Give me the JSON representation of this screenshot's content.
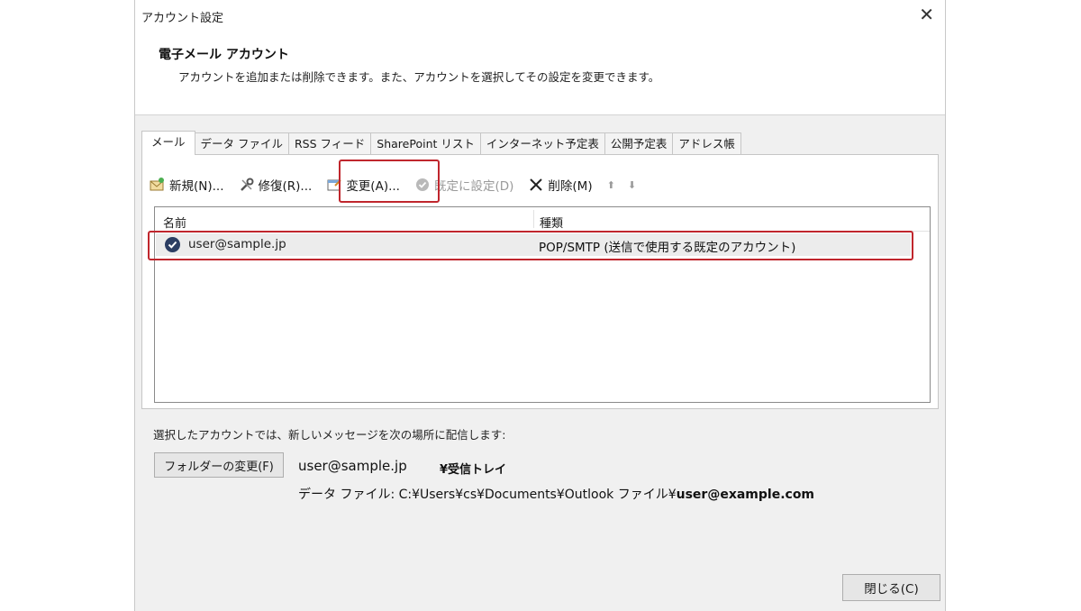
{
  "window": {
    "title": "アカウント設定",
    "close_glyph": "✕"
  },
  "header": {
    "heading": "電子メール アカウント",
    "description": "アカウントを追加または削除できます。また、アカウントを選択してその設定を変更できます。"
  },
  "tabs": [
    {
      "label": "メール",
      "active": true
    },
    {
      "label": "データ ファイル"
    },
    {
      "label": "RSS フィード"
    },
    {
      "label": "SharePoint リスト"
    },
    {
      "label": "インターネット予定表"
    },
    {
      "label": "公開予定表"
    },
    {
      "label": "アドレス帳"
    }
  ],
  "toolbar": {
    "new_label": "新規(N)...",
    "repair_label": "修復(R)...",
    "change_label": "変更(A)...",
    "set_default_label": "既定に設定(D)",
    "delete_label": "削除(M)",
    "up_glyph": "⬆",
    "down_glyph": "⬇"
  },
  "list": {
    "col_name": "名前",
    "col_type": "種類",
    "rows": [
      {
        "name": "user@sample.jp",
        "type": "POP/SMTP (送信で使用する既定のアカウント)"
      }
    ]
  },
  "delivery": {
    "note": "選択したアカウントでは、新しいメッセージを次の場所に配信します:",
    "change_folder_label": "フォルダーの変更(F)",
    "address": "user@sample.jp",
    "folder": "¥受信トレイ",
    "datafile_prefix": "データ ファイル: C:¥Users¥cs¥Documents¥Outlook ファイル¥",
    "datafile_name": "user@example.com"
  },
  "footer": {
    "close_label": "閉じる(C)"
  },
  "colors": {
    "highlight": "#c0262d",
    "dialog_bg": "#f0f0f0",
    "default_check": "#2c3e63"
  }
}
